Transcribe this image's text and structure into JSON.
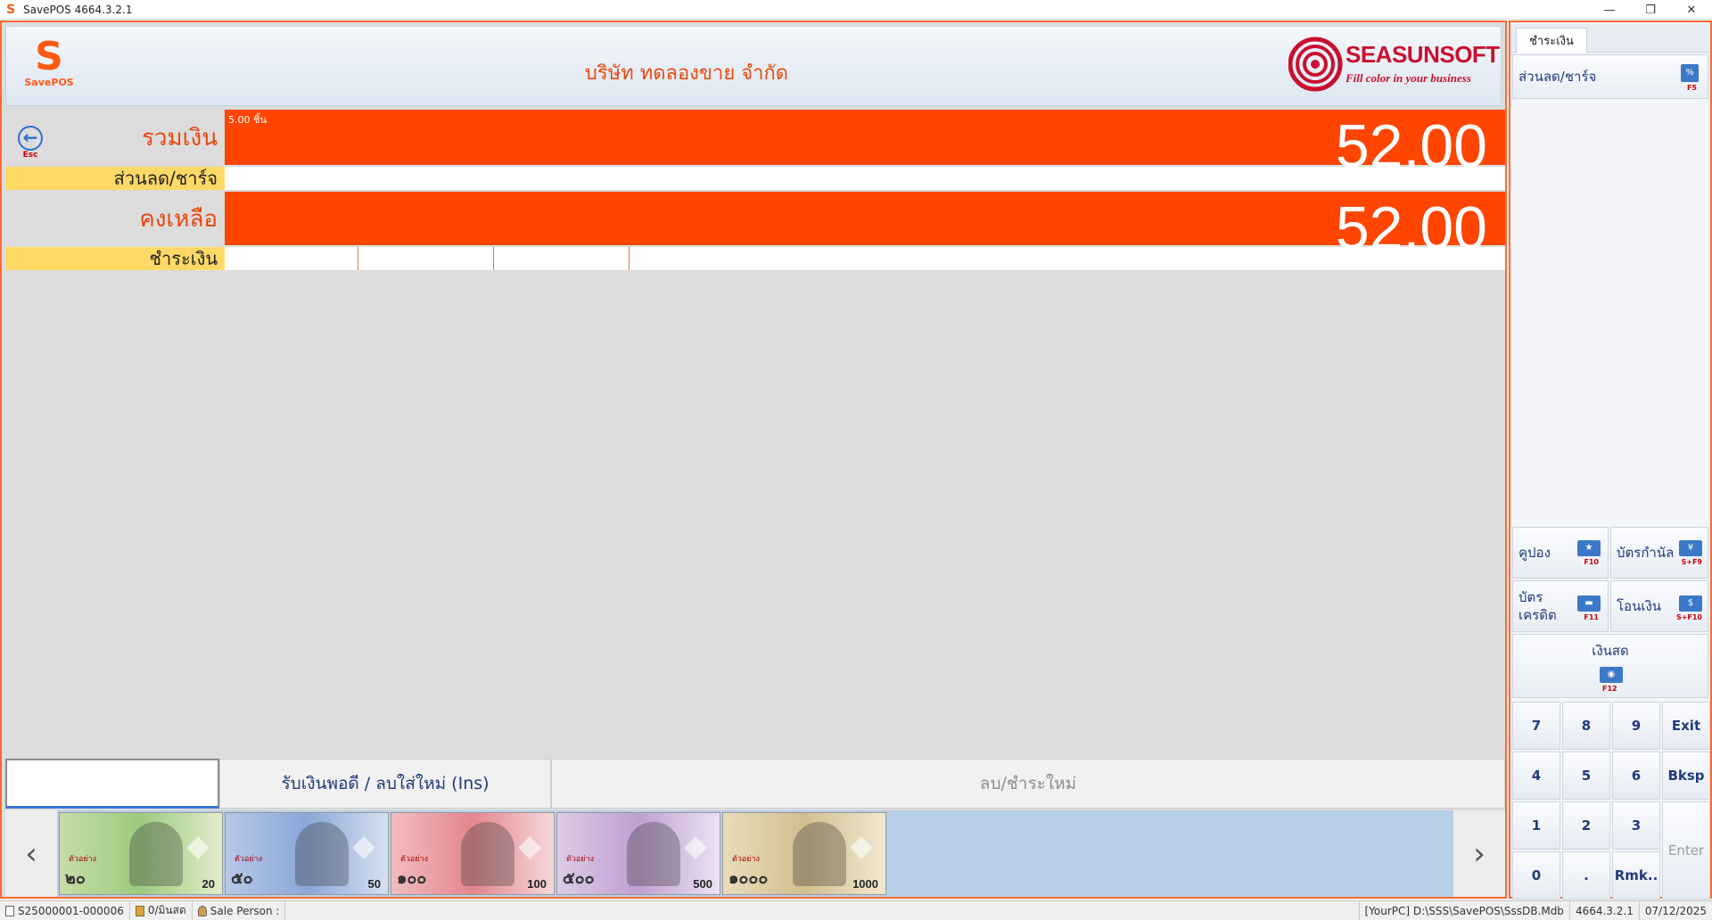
{
  "window": {
    "title": "SavePOS 4664.3.2.1",
    "minimize": "—",
    "restore": "❐",
    "close": "✕"
  },
  "header": {
    "logo_letter": "S",
    "logo_text": "SavePOS",
    "company": "บริษัท ทดลองขาย จำกัด",
    "brand_name": "SEASUNSOFT",
    "brand_slogan": "Fill color in your business"
  },
  "summary": {
    "esc_label": "Esc",
    "total_label": "รวมเงิน",
    "qty": "5.00 ชิ้น",
    "total_value": "52.00",
    "discount_label": "ส่วนลด/ชาร์จ",
    "remain_label": "คงเหลือ",
    "remain_value": "52.00",
    "payment_label": "ชำระเงิน"
  },
  "entry": {
    "input_value": "",
    "exact_button": "รับเงินพอดี / ลบใส่ใหม่ (Ins)",
    "clear_button": "ลบ/ชำระใหม่"
  },
  "bills": [
    {
      "thai": "๒๐",
      "value": "20",
      "sample": "ตัวอย่าง",
      "color": "#b9d79a"
    },
    {
      "thai": "๕๐",
      "value": "50",
      "sample": "ตัวอย่าง",
      "color": "#9fb6dc"
    },
    {
      "thai": "๑๐๐",
      "value": "100",
      "sample": "ตัวอย่าง",
      "color": "#e8a3a8"
    },
    {
      "thai": "๕๐๐",
      "value": "500",
      "sample": "ตัวอย่าง",
      "color": "#c9b1d6"
    },
    {
      "thai": "๑๐๐๐",
      "value": "1000",
      "sample": "ตัวอย่าง",
      "color": "#d9cba5"
    }
  ],
  "right_panel": {
    "tab": "ชำระเงิน",
    "discount_btn": "ส่วนลด/ชาร์จ",
    "discount_key": "F5",
    "coupon_btn": "คูปอง",
    "coupon_key": "F10",
    "card_predef_btn": "บัตรกำนัล",
    "card_predef_key": "S+F9",
    "credit_btn_1": "บัตร",
    "credit_btn_2": "เครดิต",
    "credit_key": "F11",
    "transfer_btn": "โอนเงิน",
    "transfer_key": "S+F10",
    "cash_btn": "เงินสด",
    "cash_key": "F12"
  },
  "numpad": {
    "k7": "7",
    "k8": "8",
    "k9": "9",
    "exit": "Exit",
    "k4": "4",
    "k5": "5",
    "k6": "6",
    "bksp": "Bksp",
    "k1": "1",
    "k2": "2",
    "k3": "3",
    "enter": "Enter",
    "k0": "0",
    "dot": ".",
    "rmk": "Rmk.."
  },
  "status": {
    "doc": "S25000001-000006",
    "member": "0/มินสด",
    "sales": "Sale Person :",
    "db": "[YourPC] D:\\SSS\\SavePOS\\SssDB.Mdb",
    "version": "4664.3.2.1",
    "date": "07/12/2025"
  },
  "colors": {
    "accent_orange": "#ff4500",
    "label_orange": "#e8470e",
    "yellow": "#ffd966",
    "brand_red": "#c8102e"
  }
}
